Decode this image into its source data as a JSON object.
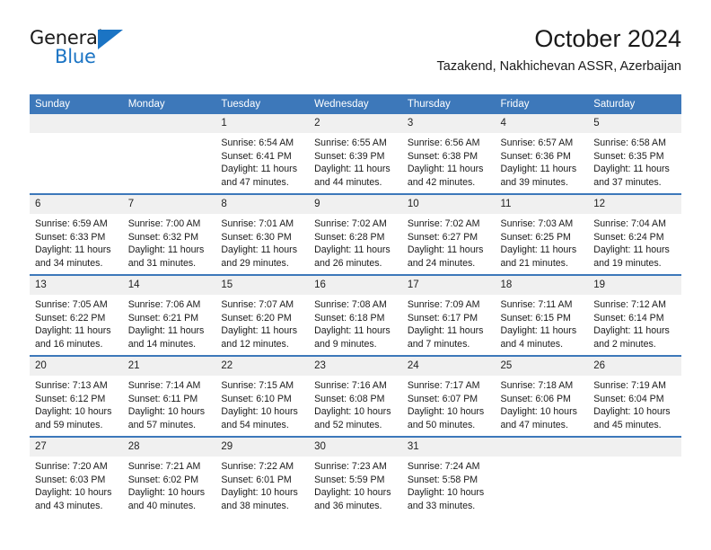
{
  "brand": {
    "name_part1": "General",
    "name_part2": "Blue",
    "accent_color": "#1b74c4"
  },
  "header": {
    "title": "October 2024",
    "subtitle": "Tazakend, Nakhichevan ASSR, Azerbaijan"
  },
  "theme": {
    "header_blue": "#3d78ba",
    "daynum_background": "#f0f0f0"
  },
  "weekday_headers": [
    "Sunday",
    "Monday",
    "Tuesday",
    "Wednesday",
    "Thursday",
    "Friday",
    "Saturday"
  ],
  "weeks": [
    [
      {
        "day": "",
        "sunrise": "",
        "sunset": "",
        "daylight1": "",
        "daylight2": ""
      },
      {
        "day": "",
        "sunrise": "",
        "sunset": "",
        "daylight1": "",
        "daylight2": ""
      },
      {
        "day": "1",
        "sunrise": "Sunrise: 6:54 AM",
        "sunset": "Sunset: 6:41 PM",
        "daylight1": "Daylight: 11 hours",
        "daylight2": "and 47 minutes."
      },
      {
        "day": "2",
        "sunrise": "Sunrise: 6:55 AM",
        "sunset": "Sunset: 6:39 PM",
        "daylight1": "Daylight: 11 hours",
        "daylight2": "and 44 minutes."
      },
      {
        "day": "3",
        "sunrise": "Sunrise: 6:56 AM",
        "sunset": "Sunset: 6:38 PM",
        "daylight1": "Daylight: 11 hours",
        "daylight2": "and 42 minutes."
      },
      {
        "day": "4",
        "sunrise": "Sunrise: 6:57 AM",
        "sunset": "Sunset: 6:36 PM",
        "daylight1": "Daylight: 11 hours",
        "daylight2": "and 39 minutes."
      },
      {
        "day": "5",
        "sunrise": "Sunrise: 6:58 AM",
        "sunset": "Sunset: 6:35 PM",
        "daylight1": "Daylight: 11 hours",
        "daylight2": "and 37 minutes."
      }
    ],
    [
      {
        "day": "6",
        "sunrise": "Sunrise: 6:59 AM",
        "sunset": "Sunset: 6:33 PM",
        "daylight1": "Daylight: 11 hours",
        "daylight2": "and 34 minutes."
      },
      {
        "day": "7",
        "sunrise": "Sunrise: 7:00 AM",
        "sunset": "Sunset: 6:32 PM",
        "daylight1": "Daylight: 11 hours",
        "daylight2": "and 31 minutes."
      },
      {
        "day": "8",
        "sunrise": "Sunrise: 7:01 AM",
        "sunset": "Sunset: 6:30 PM",
        "daylight1": "Daylight: 11 hours",
        "daylight2": "and 29 minutes."
      },
      {
        "day": "9",
        "sunrise": "Sunrise: 7:02 AM",
        "sunset": "Sunset: 6:28 PM",
        "daylight1": "Daylight: 11 hours",
        "daylight2": "and 26 minutes."
      },
      {
        "day": "10",
        "sunrise": "Sunrise: 7:02 AM",
        "sunset": "Sunset: 6:27 PM",
        "daylight1": "Daylight: 11 hours",
        "daylight2": "and 24 minutes."
      },
      {
        "day": "11",
        "sunrise": "Sunrise: 7:03 AM",
        "sunset": "Sunset: 6:25 PM",
        "daylight1": "Daylight: 11 hours",
        "daylight2": "and 21 minutes."
      },
      {
        "day": "12",
        "sunrise": "Sunrise: 7:04 AM",
        "sunset": "Sunset: 6:24 PM",
        "daylight1": "Daylight: 11 hours",
        "daylight2": "and 19 minutes."
      }
    ],
    [
      {
        "day": "13",
        "sunrise": "Sunrise: 7:05 AM",
        "sunset": "Sunset: 6:22 PM",
        "daylight1": "Daylight: 11 hours",
        "daylight2": "and 16 minutes."
      },
      {
        "day": "14",
        "sunrise": "Sunrise: 7:06 AM",
        "sunset": "Sunset: 6:21 PM",
        "daylight1": "Daylight: 11 hours",
        "daylight2": "and 14 minutes."
      },
      {
        "day": "15",
        "sunrise": "Sunrise: 7:07 AM",
        "sunset": "Sunset: 6:20 PM",
        "daylight1": "Daylight: 11 hours",
        "daylight2": "and 12 minutes."
      },
      {
        "day": "16",
        "sunrise": "Sunrise: 7:08 AM",
        "sunset": "Sunset: 6:18 PM",
        "daylight1": "Daylight: 11 hours",
        "daylight2": "and 9 minutes."
      },
      {
        "day": "17",
        "sunrise": "Sunrise: 7:09 AM",
        "sunset": "Sunset: 6:17 PM",
        "daylight1": "Daylight: 11 hours",
        "daylight2": "and 7 minutes."
      },
      {
        "day": "18",
        "sunrise": "Sunrise: 7:11 AM",
        "sunset": "Sunset: 6:15 PM",
        "daylight1": "Daylight: 11 hours",
        "daylight2": "and 4 minutes."
      },
      {
        "day": "19",
        "sunrise": "Sunrise: 7:12 AM",
        "sunset": "Sunset: 6:14 PM",
        "daylight1": "Daylight: 11 hours",
        "daylight2": "and 2 minutes."
      }
    ],
    [
      {
        "day": "20",
        "sunrise": "Sunrise: 7:13 AM",
        "sunset": "Sunset: 6:12 PM",
        "daylight1": "Daylight: 10 hours",
        "daylight2": "and 59 minutes."
      },
      {
        "day": "21",
        "sunrise": "Sunrise: 7:14 AM",
        "sunset": "Sunset: 6:11 PM",
        "daylight1": "Daylight: 10 hours",
        "daylight2": "and 57 minutes."
      },
      {
        "day": "22",
        "sunrise": "Sunrise: 7:15 AM",
        "sunset": "Sunset: 6:10 PM",
        "daylight1": "Daylight: 10 hours",
        "daylight2": "and 54 minutes."
      },
      {
        "day": "23",
        "sunrise": "Sunrise: 7:16 AM",
        "sunset": "Sunset: 6:08 PM",
        "daylight1": "Daylight: 10 hours",
        "daylight2": "and 52 minutes."
      },
      {
        "day": "24",
        "sunrise": "Sunrise: 7:17 AM",
        "sunset": "Sunset: 6:07 PM",
        "daylight1": "Daylight: 10 hours",
        "daylight2": "and 50 minutes."
      },
      {
        "day": "25",
        "sunrise": "Sunrise: 7:18 AM",
        "sunset": "Sunset: 6:06 PM",
        "daylight1": "Daylight: 10 hours",
        "daylight2": "and 47 minutes."
      },
      {
        "day": "26",
        "sunrise": "Sunrise: 7:19 AM",
        "sunset": "Sunset: 6:04 PM",
        "daylight1": "Daylight: 10 hours",
        "daylight2": "and 45 minutes."
      }
    ],
    [
      {
        "day": "27",
        "sunrise": "Sunrise: 7:20 AM",
        "sunset": "Sunset: 6:03 PM",
        "daylight1": "Daylight: 10 hours",
        "daylight2": "and 43 minutes."
      },
      {
        "day": "28",
        "sunrise": "Sunrise: 7:21 AM",
        "sunset": "Sunset: 6:02 PM",
        "daylight1": "Daylight: 10 hours",
        "daylight2": "and 40 minutes."
      },
      {
        "day": "29",
        "sunrise": "Sunrise: 7:22 AM",
        "sunset": "Sunset: 6:01 PM",
        "daylight1": "Daylight: 10 hours",
        "daylight2": "and 38 minutes."
      },
      {
        "day": "30",
        "sunrise": "Sunrise: 7:23 AM",
        "sunset": "Sunset: 5:59 PM",
        "daylight1": "Daylight: 10 hours",
        "daylight2": "and 36 minutes."
      },
      {
        "day": "31",
        "sunrise": "Sunrise: 7:24 AM",
        "sunset": "Sunset: 5:58 PM",
        "daylight1": "Daylight: 10 hours",
        "daylight2": "and 33 minutes."
      },
      {
        "day": "",
        "sunrise": "",
        "sunset": "",
        "daylight1": "",
        "daylight2": ""
      },
      {
        "day": "",
        "sunrise": "",
        "sunset": "",
        "daylight1": "",
        "daylight2": ""
      }
    ]
  ]
}
